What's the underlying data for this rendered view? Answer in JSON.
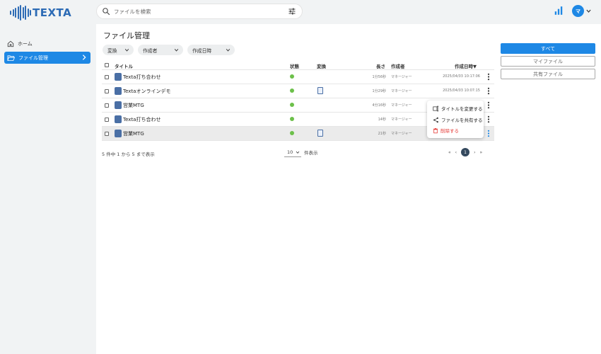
{
  "app": {
    "logo_text": "TEXTA",
    "brand_color": "#2d6bb5",
    "accent_color": "#1e88e5"
  },
  "search": {
    "placeholder": "ファイルを検索"
  },
  "user": {
    "avatar_initial": "マ"
  },
  "sidebar": {
    "items": [
      {
        "label": "ホーム",
        "icon": "home-icon",
        "active": false
      },
      {
        "label": "ファイル管理",
        "icon": "folder-open-icon",
        "active": true
      }
    ]
  },
  "page": {
    "title": "ファイル管理"
  },
  "filters": [
    {
      "label": "変換"
    },
    {
      "label": "作成者"
    },
    {
      "label": "作成日時"
    }
  ],
  "table": {
    "headers": {
      "title": "タイトル",
      "status": "状態",
      "conversion": "変換",
      "length": "長さ",
      "author": "作成者",
      "created": "作成日時▼"
    },
    "rows": [
      {
        "title": "Texta打ち合わせ",
        "length": "1分56秒",
        "author": "マネージャー",
        "created": "2025/04/03 10:17:06",
        "has_conversion": false
      },
      {
        "title": "Textaオンラインデモ",
        "length": "1分29秒",
        "author": "マネージャー",
        "created": "2025/04/03 10:07:15",
        "has_conversion": true
      },
      {
        "title": "営業MTG",
        "length": "4分16秒",
        "author": "マネージャー",
        "created": "",
        "has_conversion": false
      },
      {
        "title": "Texta打ち合わせ",
        "length": "14秒",
        "author": "マネージャー",
        "created": "",
        "has_conversion": false
      },
      {
        "title": "営業MTG",
        "length": "21秒",
        "author": "マネージャー",
        "created": "",
        "has_conversion": true
      }
    ]
  },
  "pager": {
    "info": "5 件中 1 から 5 まで表示",
    "per_page_value": "10",
    "per_page_suffix": "件表示",
    "first": "«",
    "prev": "‹",
    "current": "1",
    "next": "›",
    "last": "»"
  },
  "context_menu": {
    "items": [
      {
        "label": "タイトルを変更する",
        "icon": "rename-icon"
      },
      {
        "label": "ファイルを共有する",
        "icon": "share-icon"
      },
      {
        "label": "削除する",
        "icon": "trash-icon",
        "danger_color": "#e53935"
      }
    ]
  },
  "view_buttons": {
    "all": "すべて",
    "mine": "マイファイル",
    "shared": "共有ファイル"
  }
}
